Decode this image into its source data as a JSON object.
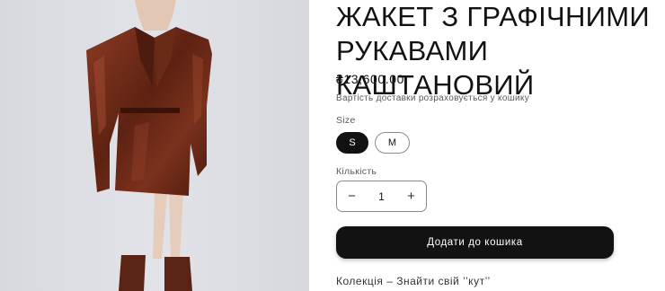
{
  "product": {
    "title": "ЖАКЕТ З ГРАФІЧНИМИ\nРУКАВАМИ КАШТАНОВИЙ",
    "price": "₴13,600.00",
    "shipping_note": "Вартість доставки розраховується у кошику",
    "image": {
      "background": "#dcdde3",
      "garment_color": "#6b2a1a"
    }
  },
  "size": {
    "label": "Size",
    "options": [
      {
        "label": "S",
        "selected": true
      },
      {
        "label": "M",
        "selected": false
      }
    ]
  },
  "quantity": {
    "label": "Кількість",
    "value": "1",
    "decrement_symbol": "−",
    "increment_symbol": "+"
  },
  "cart": {
    "add_label": "Додати до кошика"
  },
  "collection_link": "Колекція – Знайти свій ’’кут’’",
  "colors": {
    "accent": "#121212",
    "muted_text": "#5a5a5a"
  }
}
